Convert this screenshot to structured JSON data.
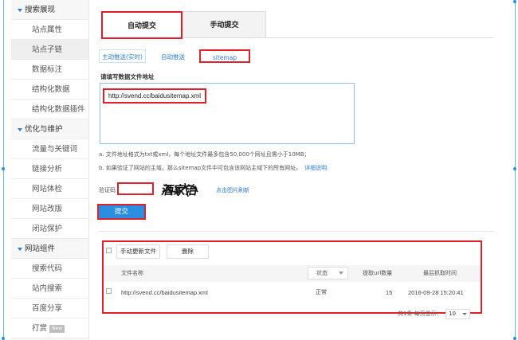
{
  "sidebar": {
    "groups": [
      {
        "label": "搜索展现",
        "items": [
          "站点属性",
          "站点子链",
          "数据标注",
          "结构化数据",
          "结构化数据插件"
        ]
      },
      {
        "label": "优化与维护",
        "items": [
          "流量与关键词",
          "链接分析",
          "网站体检",
          "网站改版",
          "闭站保护"
        ]
      },
      {
        "label": "网站组件",
        "items": [
          "搜索代码",
          "站内搜索",
          "百度分享",
          "打赏"
        ]
      }
    ],
    "new_badge": "New"
  },
  "tabs": {
    "auto": "自动提交",
    "manual": "手动提交"
  },
  "subtabs": {
    "realtime": "主动推送(实时)",
    "auto": "自动推送",
    "sitemap": "sitemap"
  },
  "form": {
    "url_label": "请填写数据文件地址",
    "url_value": "http://svend.cc/baidusitemap.xml",
    "note_a": "a. 文件地址格式为txt或xml，每个地址文件最多包含50,000个网址且需小于10MB；",
    "note_b": "b. 如果验证了网站的主域，那么sitemap文件中可包含该网站主域下的所有网址。",
    "note_b_link": "详细说明",
    "captcha_label": "验证码",
    "captcha_text": "酒家治",
    "captcha_refresh": "点击图片刷新",
    "submit": "提交"
  },
  "file_table": {
    "btn_update": "手动更新文件",
    "btn_delete": "删除",
    "headers": {
      "name": "文件名称",
      "status": "状态",
      "count": "提取url数量",
      "time": "最后抓取时间"
    },
    "rows": [
      {
        "name": "http://svend.cc/baidusitemap.xml",
        "status": "正常",
        "count": "15",
        "time": "2016-09-28 15:20:41"
      }
    ],
    "pager": "共1条 每页显示：",
    "page_size": "10"
  },
  "colors": {
    "accent": "#2a8fe0",
    "highlight": "#e0202a"
  }
}
